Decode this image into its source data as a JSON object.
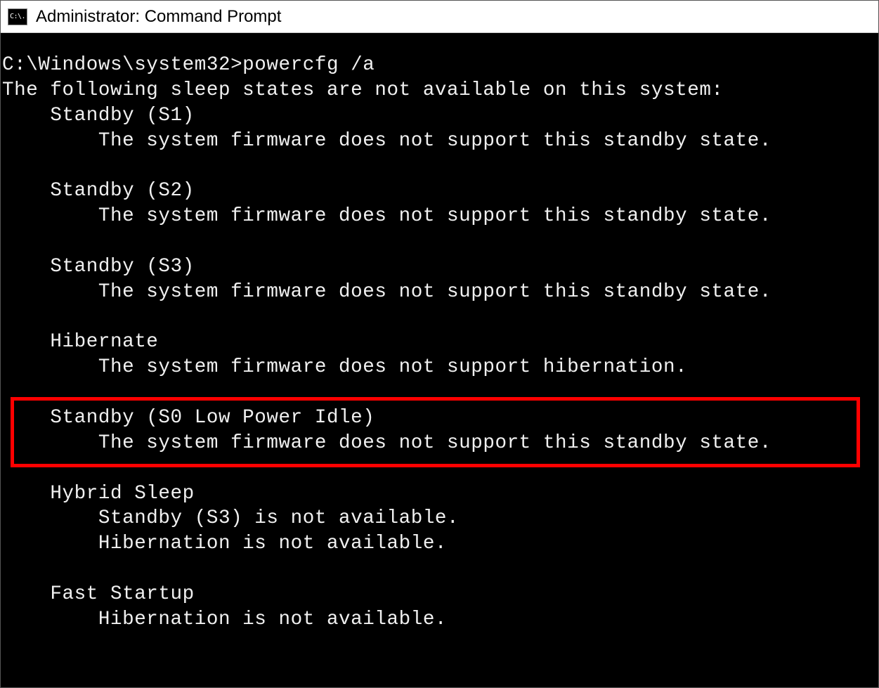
{
  "window": {
    "title": "Administrator: Command Prompt",
    "icon_label": "C:\\."
  },
  "terminal": {
    "prompt": "C:\\Windows\\system32>",
    "command": "powercfg /a",
    "header": "The following sleep states are not available on this system:",
    "states": [
      {
        "name": "Standby (S1)",
        "reasons": [
          "The system firmware does not support this standby state."
        ]
      },
      {
        "name": "Standby (S2)",
        "reasons": [
          "The system firmware does not support this standby state."
        ]
      },
      {
        "name": "Standby (S3)",
        "reasons": [
          "The system firmware does not support this standby state."
        ]
      },
      {
        "name": "Hibernate",
        "reasons": [
          "The system firmware does not support hibernation."
        ]
      },
      {
        "name": "Standby (S0 Low Power Idle)",
        "reasons": [
          "The system firmware does not support this standby state."
        ]
      },
      {
        "name": "Hybrid Sleep",
        "reasons": [
          "Standby (S3) is not available.",
          "Hibernation is not available."
        ]
      },
      {
        "name": "Fast Startup",
        "reasons": [
          "Hibernation is not available."
        ]
      }
    ],
    "highlighted_state_index": 4
  },
  "highlight": {
    "color": "#ff0000"
  }
}
